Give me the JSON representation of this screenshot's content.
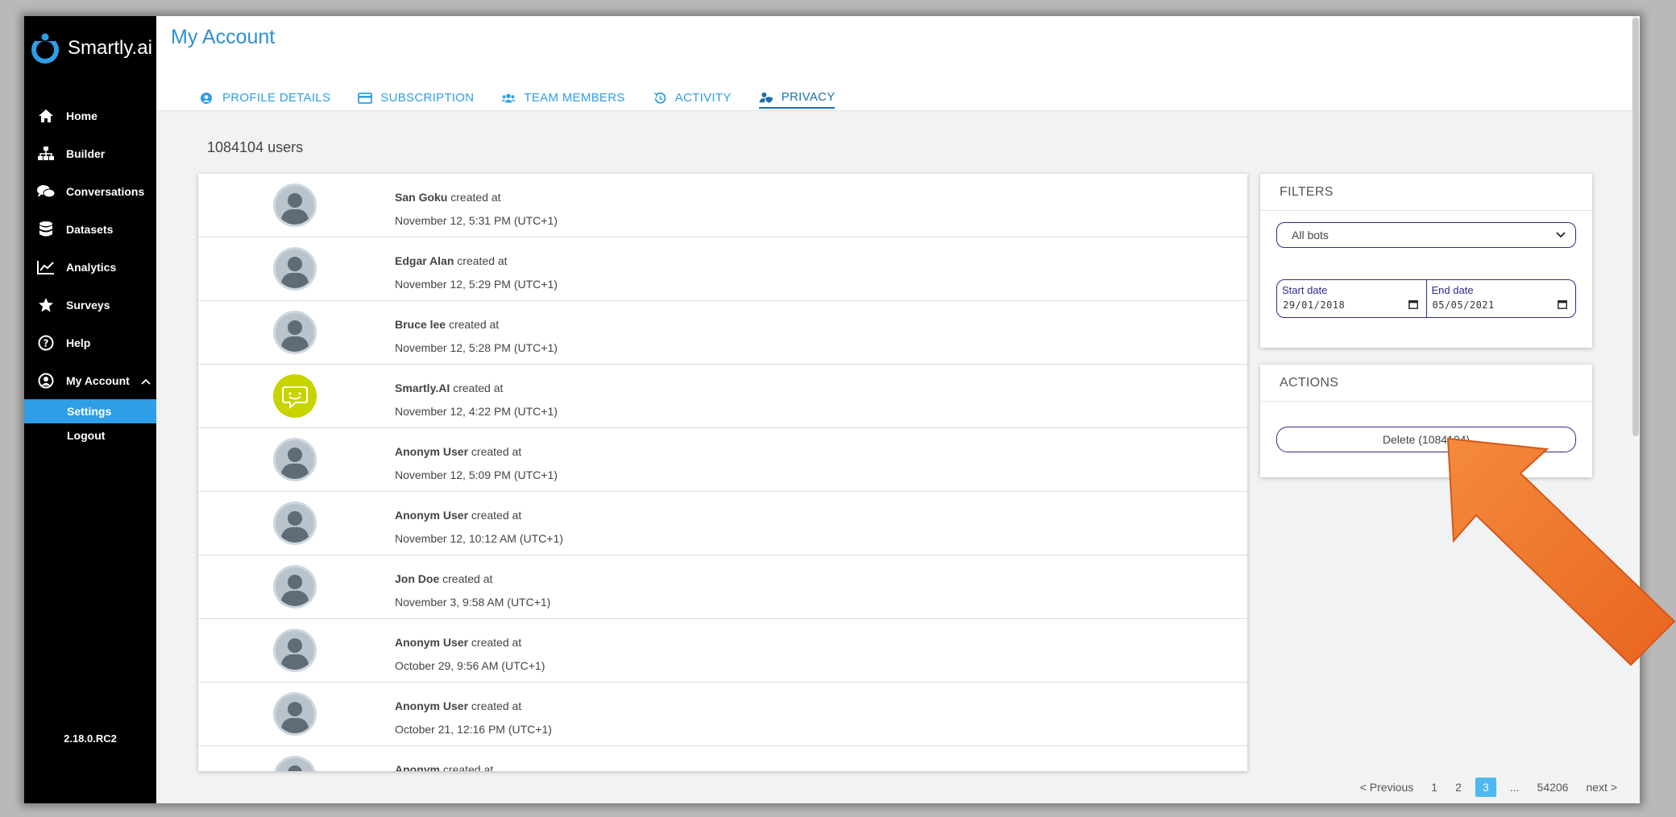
{
  "sidebar": {
    "brand": "Smartly.ai",
    "items": [
      {
        "label": "Home",
        "icon": "home-icon"
      },
      {
        "label": "Builder",
        "icon": "sitemap-icon"
      },
      {
        "label": "Conversations",
        "icon": "chat-bubbles-icon"
      },
      {
        "label": "Datasets",
        "icon": "database-icon"
      },
      {
        "label": "Analytics",
        "icon": "line-chart-icon"
      },
      {
        "label": "Surveys",
        "icon": "star-icon"
      },
      {
        "label": "Help",
        "icon": "question-circle-icon"
      },
      {
        "label": "My Account",
        "icon": "user-circle-icon"
      }
    ],
    "sub_items": [
      {
        "label": "Settings",
        "active": true
      },
      {
        "label": "Logout",
        "active": false
      }
    ],
    "version": "2.18.0.RC2"
  },
  "header": {
    "title": "My Account",
    "tabs": [
      {
        "label": "PROFILE DETAILS",
        "icon": "user-circle-icon",
        "active": false
      },
      {
        "label": "SUBSCRIPTION",
        "icon": "credit-card-icon",
        "active": false
      },
      {
        "label": "TEAM MEMBERS",
        "icon": "users-icon",
        "active": false
      },
      {
        "label": "ACTIVITY",
        "icon": "history-icon",
        "active": false
      },
      {
        "label": "PRIVACY",
        "icon": "user-shield-icon",
        "active": true
      }
    ]
  },
  "users": {
    "count_label": "1084104 users",
    "created_text": "created at",
    "rows": [
      {
        "name": "San Goku",
        "date": "November 12, 5:31 PM (UTC+1)",
        "avatar": "default"
      },
      {
        "name": "Edgar Alan",
        "date": "November 12, 5:29 PM (UTC+1)",
        "avatar": "default"
      },
      {
        "name": "Bruce lee",
        "date": "November 12, 5:28 PM (UTC+1)",
        "avatar": "default"
      },
      {
        "name": "Smartly.AI",
        "date": "November 12, 4:22 PM (UTC+1)",
        "avatar": "bot"
      },
      {
        "name": "Anonym User",
        "date": "November 12, 5:09 PM (UTC+1)",
        "avatar": "default"
      },
      {
        "name": "Anonym User",
        "date": "November 12, 10:12 AM (UTC+1)",
        "avatar": "default"
      },
      {
        "name": "Jon Doe",
        "date": "November 3, 9:58 AM (UTC+1)",
        "avatar": "default"
      },
      {
        "name": "Anonym User",
        "date": "October 29, 9:56 AM (UTC+1)",
        "avatar": "default"
      },
      {
        "name": "Anonym User",
        "date": "October 21, 12:16 PM (UTC+1)",
        "avatar": "default"
      },
      {
        "name": "Anonym",
        "date": "",
        "avatar": "default"
      }
    ]
  },
  "filters": {
    "title": "FILTERS",
    "bot_select": "All bots",
    "start_label": "Start date",
    "start_value": "29/01/2018",
    "end_label": "End date",
    "end_value": "05/05/2021"
  },
  "actions": {
    "title": "ACTIONS",
    "delete_label": "Delete (1084104)"
  },
  "pagination": {
    "previous": "< Previous",
    "pages": [
      "1",
      "2",
      "3",
      "...",
      "54206"
    ],
    "active_page": "3",
    "next": "next >"
  },
  "colors": {
    "accent": "#2e9ee6",
    "title": "#2e8fce",
    "sidebar_bg": "#000000",
    "active_nav": "#2e9ee6",
    "border_input": "#2a2d8f",
    "annotation_arrow": "#f07a2a",
    "bot_avatar": "#c7d400"
  }
}
